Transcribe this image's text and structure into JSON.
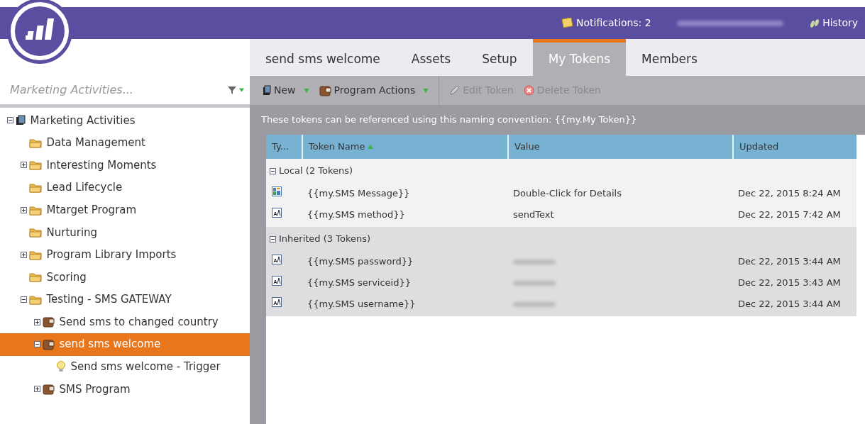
{
  "header": {
    "notifications": "Notifications: 2",
    "user_redacted": true,
    "history": "History"
  },
  "sidebar": {
    "search": {
      "placeholder": "Marketing Activities..."
    },
    "tree": [
      {
        "label": "Marketing Activities",
        "kind": "root",
        "expanded": true,
        "selected": false,
        "children": [
          {
            "label": "Data Management",
            "kind": "folder",
            "selected": false
          },
          {
            "label": "Interesting Moments",
            "kind": "folder",
            "expanded": false,
            "selected": false
          },
          {
            "label": "Lead Lifecycle",
            "kind": "folder",
            "selected": false
          },
          {
            "label": "Mtarget Program",
            "kind": "folder",
            "expanded": false,
            "selected": false
          },
          {
            "label": "Nurturing",
            "kind": "folder",
            "selected": false
          },
          {
            "label": "Program Library Imports",
            "kind": "folder",
            "expanded": false,
            "selected": false
          },
          {
            "label": "Scoring",
            "kind": "folder",
            "selected": false
          },
          {
            "label": "Testing - SMS GATEWAY",
            "kind": "folder",
            "expanded": true,
            "selected": false,
            "children": [
              {
                "label": "Send sms to changed country",
                "kind": "program",
                "expanded": false,
                "selected": false
              },
              {
                "label": "send sms welcome",
                "kind": "program",
                "expanded": true,
                "selected": true,
                "children": [
                  {
                    "label": "Send sms welcome - Trigger",
                    "kind": "campaign",
                    "selected": false
                  }
                ]
              },
              {
                "label": "SMS Program",
                "kind": "program",
                "expanded": false,
                "selected": false
              }
            ]
          }
        ]
      }
    ]
  },
  "tabs": [
    {
      "label": "send sms welcome",
      "selected": false
    },
    {
      "label": "Assets",
      "selected": false
    },
    {
      "label": "Setup",
      "selected": false
    },
    {
      "label": "My Tokens",
      "selected": true
    },
    {
      "label": "Members",
      "selected": false
    }
  ],
  "toolbar": [
    {
      "label": "New",
      "kind": "book",
      "dropdown": true,
      "disabled": false
    },
    {
      "label": "Program Actions",
      "kind": "program",
      "dropdown": true,
      "disabled": false
    },
    {
      "label": "Edit Token",
      "kind": "pencil",
      "dropdown": false,
      "disabled": true
    },
    {
      "label": "Delete Token",
      "kind": "delete",
      "dropdown": false,
      "disabled": true
    }
  ],
  "info": "These tokens can be referenced using this naming convention: {{my.My Token}}",
  "table": {
    "columns": [
      "Ty...",
      "Token Name",
      "Value",
      "Updated"
    ],
    "groups": [
      {
        "label": "Local (2 Tokens)",
        "expanded": true,
        "rows": [
          {
            "kind": "rich",
            "name": "{{my.SMS Message}}",
            "value": "Double-Click for Details",
            "updated": "Dec 22, 2015 8:24 AM"
          },
          {
            "kind": "text",
            "name": "{{my.SMS method}}",
            "value": "sendText",
            "updated": "Dec 22, 2015 7:42 AM"
          }
        ]
      },
      {
        "label": "Inherited (3 Tokens)",
        "expanded": true,
        "rows": [
          {
            "kind": "text",
            "name": "{{my.SMS password}}",
            "value_redacted": true,
            "updated": "Dec 22, 2015 3:44 AM"
          },
          {
            "kind": "text",
            "name": "{{my.SMS serviceid}}",
            "value_redacted": true,
            "updated": "Dec 22, 2015 3:43 AM"
          },
          {
            "kind": "text",
            "name": "{{my.SMS username}}",
            "value_redacted": true,
            "updated": "Dec 22, 2015 3:44 AM"
          }
        ]
      }
    ]
  }
}
